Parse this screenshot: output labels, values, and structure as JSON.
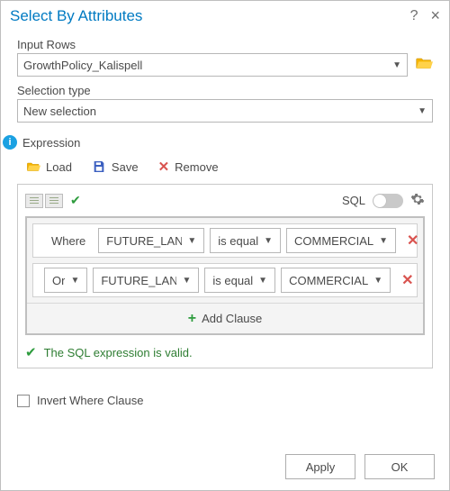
{
  "window": {
    "title": "Select By Attributes"
  },
  "inputRows": {
    "label": "Input Rows",
    "value": "GrowthPolicy_Kalispell"
  },
  "selectionType": {
    "label": "Selection type",
    "value": "New selection"
  },
  "expression": {
    "label": "Expression",
    "load": "Load",
    "save": "Save",
    "remove": "Remove",
    "sqlLabel": "SQL",
    "addClause": "Add Clause",
    "validText": "The SQL expression is valid."
  },
  "clauses": [
    {
      "logic": "Where",
      "field": "FUTURE_LAN",
      "op": "is equal",
      "value": "COMMERCIAL"
    },
    {
      "logic": "Or",
      "field": "FUTURE_LAN",
      "op": "is equal",
      "value": "COMMERCIAL"
    }
  ],
  "invert": {
    "label": "Invert Where Clause",
    "checked": false
  },
  "buttons": {
    "apply": "Apply",
    "ok": "OK"
  }
}
